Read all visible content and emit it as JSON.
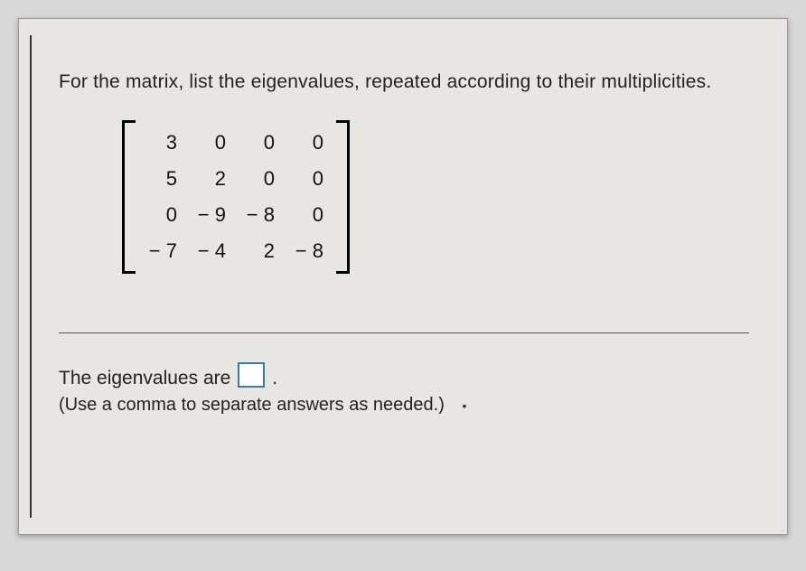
{
  "question": "For the matrix, list the eigenvalues, repeated according to their multiplicities.",
  "matrix": {
    "rows": [
      [
        "3",
        "0",
        "0",
        "0"
      ],
      [
        "5",
        "2",
        "0",
        "0"
      ],
      [
        "0",
        "− 9",
        "− 8",
        "0"
      ],
      [
        "− 7",
        "− 4",
        "2",
        "− 8"
      ]
    ]
  },
  "answer_prefix": "The eigenvalues are",
  "answer_suffix": ".",
  "instruction": "(Use a comma to separate answers as needed.)",
  "tail_dot": "•"
}
